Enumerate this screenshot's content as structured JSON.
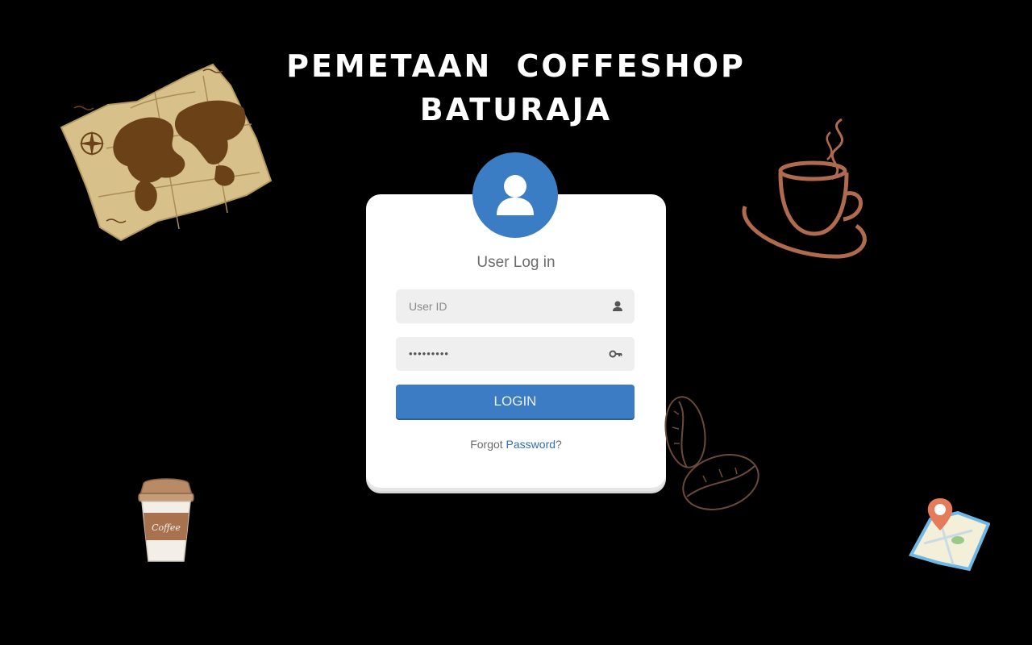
{
  "header": {
    "title_line1": "PEMETAAN  COFFESHOP",
    "title_line2": "BATURAJA"
  },
  "login": {
    "heading": "User Log in",
    "user_id_placeholder": "User ID",
    "password_value": "•••••••••",
    "login_button": "LOGIN",
    "forgot_prefix": "Forgot",
    "forgot_link": "Password",
    "forgot_suffix": "?"
  },
  "icons": {
    "avatar": "user-avatar-icon",
    "user_field": "user-icon",
    "password_field": "key-icon",
    "decor": [
      "treasure-map-illustration",
      "coffee-cup-illustration",
      "coffee-beans-illustration",
      "takeaway-coffee-cup-illustration",
      "map-pin-illustration"
    ]
  },
  "colors": {
    "background": "#000000",
    "accent_blue": "#3b7cc4",
    "card": "#ffffff",
    "field_bg": "#efefef"
  },
  "decor_text": {
    "cup_label": "Coffee"
  }
}
